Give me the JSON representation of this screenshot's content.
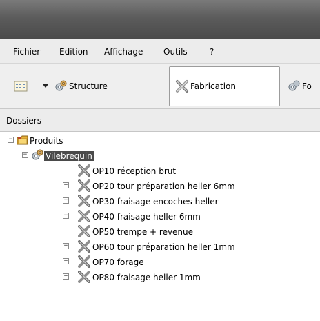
{
  "menu": {
    "items": [
      "Fichier",
      "Edition",
      "Affichage",
      "Outils",
      "?"
    ]
  },
  "toolbar": {
    "structure_label": "Structure",
    "fabrication_label": "Fabrication",
    "truncated_label": "Fo"
  },
  "panel": {
    "title": "Dossiers"
  },
  "tree": {
    "root": "Produits",
    "product": "Vilebrequin",
    "operations": [
      {
        "label": "OP10 réception brut",
        "expandable": false
      },
      {
        "label": "OP20 tour préparation heller 6mm",
        "expandable": true
      },
      {
        "label": "OP30 fraisage encoches heller",
        "expandable": true
      },
      {
        "label": "OP40 fraisage heller 6mm",
        "expandable": true
      },
      {
        "label": "OP50 trempe + revenue",
        "expandable": false
      },
      {
        "label": "OP60 tour préparation heller 1mm",
        "expandable": true
      },
      {
        "label": "OP70 forage",
        "expandable": true
      },
      {
        "label": "OP80 fraisage heller 1mm",
        "expandable": true
      }
    ]
  },
  "icons": {
    "toolbar_view": "view-list-icon",
    "structure": "gears-icon",
    "fabrication": "tools-icon",
    "folder": "folder-icon",
    "product": "gears-icon",
    "operation": "tools-icon"
  }
}
